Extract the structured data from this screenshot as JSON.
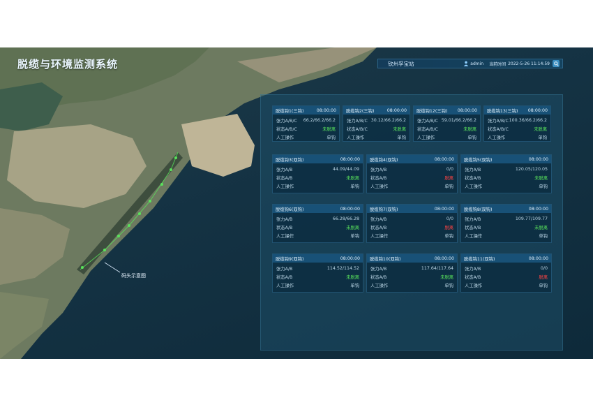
{
  "app": {
    "title": "脱缆与环境监测系统"
  },
  "topbar": {
    "station": "钦州孚宝站",
    "user": "admin",
    "time_label": "当前时间",
    "time": "2022-5-26 11:14:59"
  },
  "map": {
    "callout": "码头示意图"
  },
  "colors": {
    "ok": "#59e35b",
    "alarm": "#ff4343",
    "accent": "#3b8fc2"
  },
  "cards_top": [
    {
      "title": "脱缆钩1(三钩)",
      "time": "08:00:00",
      "tension_label": "张力A/B/C",
      "tension": "66.2/66.2/66.2",
      "status_label": "状态A/B/C",
      "status": "未脱离",
      "status_state": "ok",
      "op_label": "人工操作",
      "op": "单钩"
    },
    {
      "title": "脱缆钩2(三钩)",
      "time": "08:00:00",
      "tension_label": "张力A/B/C",
      "tension": "30.12/66.2/66.2",
      "status_label": "状态A/B/C",
      "status": "未脱离",
      "status_state": "ok",
      "op_label": "人工操作",
      "op": "单钩"
    },
    {
      "title": "脱缆钩12(三钩)",
      "time": "08:00:00",
      "tension_label": "张力A/B/C",
      "tension": "59.01/66.2/66.2",
      "status_label": "状态A/B/C",
      "status": "未脱离",
      "status_state": "ok",
      "op_label": "人工操作",
      "op": "单钩"
    },
    {
      "title": "脱缆钩13(三钩)",
      "time": "08:00:00",
      "tension_label": "张力A/B/C",
      "tension": "100.36/66.2/66.2",
      "status_label": "状态A/B/C",
      "status": "未脱离",
      "status_state": "ok",
      "op_label": "人工操作",
      "op": "单钩"
    }
  ],
  "cards": [
    {
      "title": "脱缆钩3(双钩)",
      "time": "08:00:00",
      "tension_label": "张力A/B",
      "tension": "44.09/44.09",
      "status_label": "状态A/B",
      "status": "未脱离",
      "status_state": "ok",
      "op_label": "人工操作",
      "op": "单钩"
    },
    {
      "title": "脱缆钩4(双钩)",
      "time": "08:00:00",
      "tension_label": "张力A/B",
      "tension": "0/0",
      "status_label": "状态A/B",
      "status": "脱离",
      "status_state": "alarm",
      "op_label": "人工操作",
      "op": "单钩"
    },
    {
      "title": "脱缆钩5(双钩)",
      "time": "08:00:00",
      "tension_label": "张力A/B",
      "tension": "120.05/120.05",
      "status_label": "状态A/B",
      "status": "未脱离",
      "status_state": "ok",
      "op_label": "人工操作",
      "op": "单钩"
    },
    {
      "title": "脱缆钩6(双钩)",
      "time": "08:00:00",
      "tension_label": "张力A/B",
      "tension": "66.28/66.28",
      "status_label": "状态A/B",
      "status": "未脱离",
      "status_state": "ok",
      "op_label": "人工操作",
      "op": "单钩"
    },
    {
      "title": "脱缆钩7(双钩)",
      "time": "08:00:00",
      "tension_label": "张力A/B",
      "tension": "0/0",
      "status_label": "状态A/B",
      "status": "脱离",
      "status_state": "alarm",
      "op_label": "人工操作",
      "op": "单钩"
    },
    {
      "title": "脱缆钩8(双钩)",
      "time": "08:00:00",
      "tension_label": "张力A/B",
      "tension": "109.77/109.77",
      "status_label": "状态A/B",
      "status": "未脱离",
      "status_state": "ok",
      "op_label": "人工操作",
      "op": "单钩"
    },
    {
      "title": "脱缆钩9(双钩)",
      "time": "08:00:00",
      "tension_label": "张力A/B",
      "tension": "114.52/114.52",
      "status_label": "状态A/B",
      "status": "未脱离",
      "status_state": "ok",
      "op_label": "人工操作",
      "op": "单钩"
    },
    {
      "title": "脱缆钩10(双钩)",
      "time": "08:00:00",
      "tension_label": "张力A/B",
      "tension": "117.64/117.64",
      "status_label": "状态A/B",
      "status": "未脱离",
      "status_state": "ok",
      "op_label": "人工操作",
      "op": "单钩"
    },
    {
      "title": "脱缆钩11(双钩)",
      "time": "08:00:00",
      "tension_label": "张力A/B",
      "tension": "0/0",
      "status_label": "状态A/B",
      "status": "脱离",
      "status_state": "alarm",
      "op_label": "人工操作",
      "op": "单钩"
    }
  ]
}
